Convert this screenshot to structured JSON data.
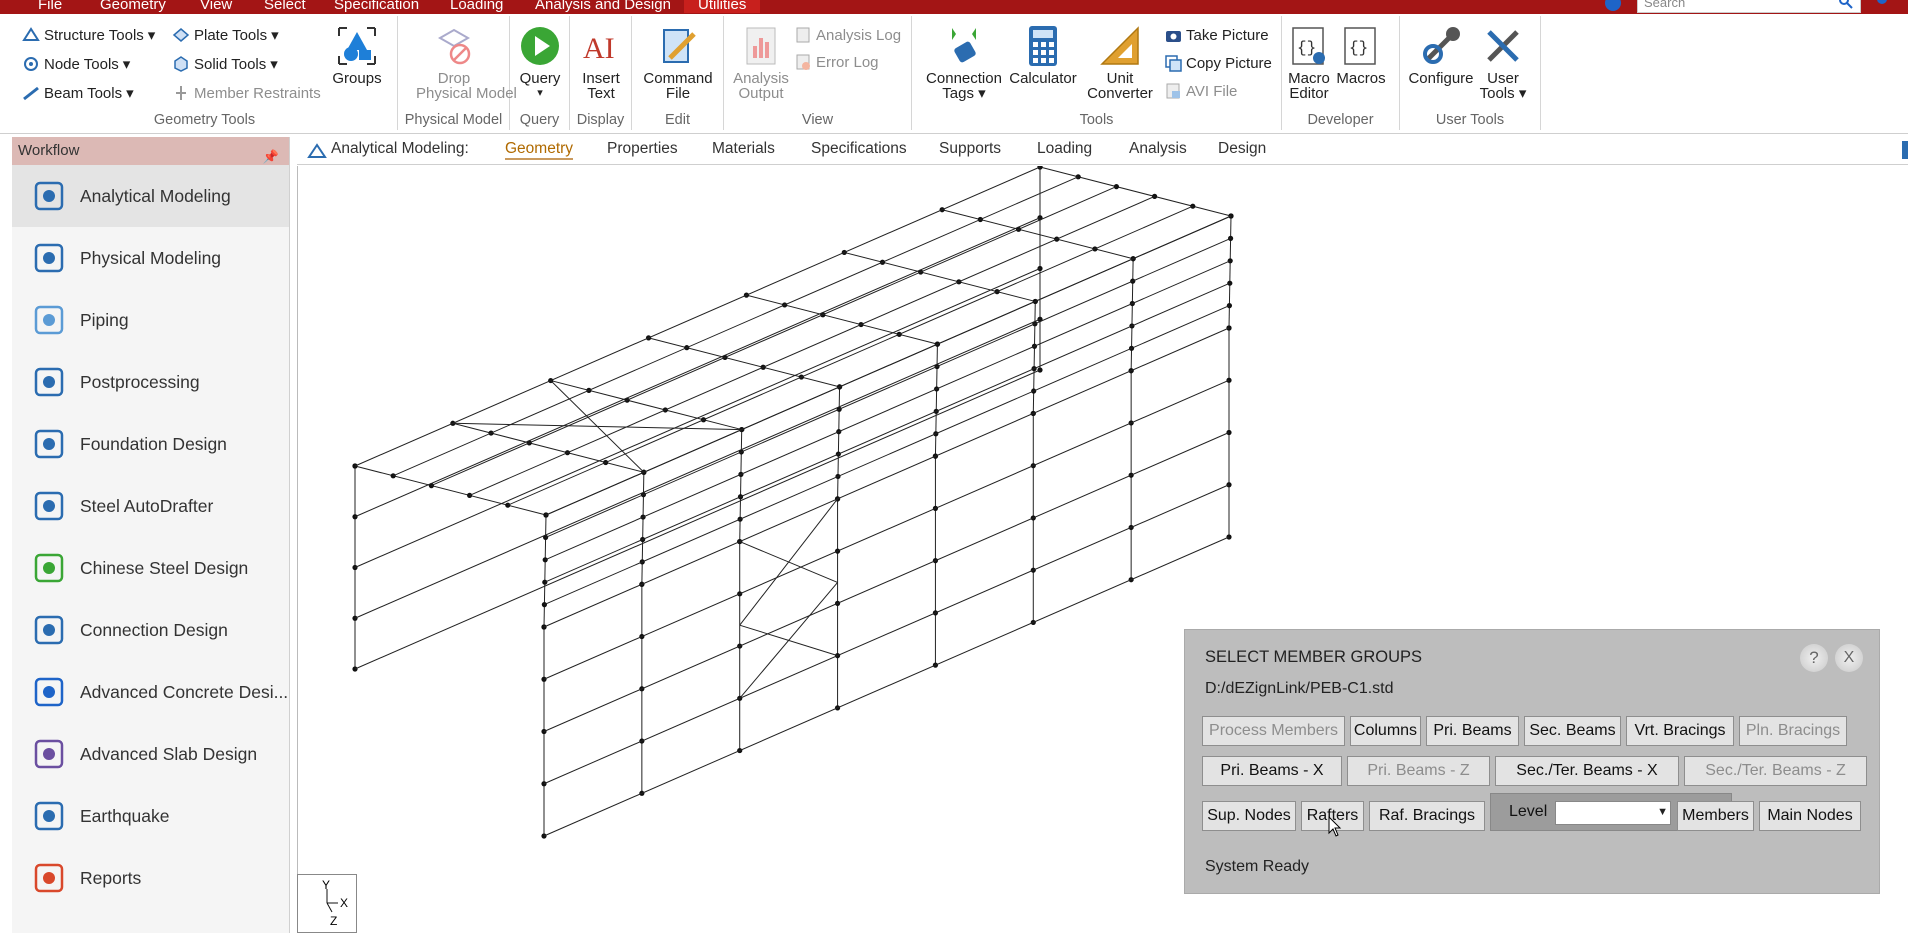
{
  "menubar": {
    "items": [
      "File",
      "Geometry",
      "View",
      "Select",
      "Specification",
      "Loading",
      "Analysis and Design",
      "Utilities"
    ],
    "active": "Utilities",
    "search_placeholder": "Search"
  },
  "ribbon": {
    "geometry_tools": {
      "structure_tools": "Structure Tools",
      "node_tools": "Node Tools",
      "beam_tools": "Beam Tools",
      "plate_tools": "Plate Tools",
      "solid_tools": "Solid Tools",
      "member_restraints": "Member Restraints",
      "groups": "Groups",
      "label": "Geometry Tools"
    },
    "physical_model": {
      "drop_line1": "Drop",
      "drop_line2": "Physical Model",
      "label": "Physical Model"
    },
    "query": {
      "button": "Query",
      "label": "Query"
    },
    "display": {
      "insert_line1": "Insert",
      "insert_line2": "Text",
      "label": "Display"
    },
    "edit": {
      "command_line1": "Command",
      "command_line2": "File",
      "label": "Edit"
    },
    "view": {
      "analysis_output_line1": "Analysis",
      "analysis_output_line2": "Output",
      "analysis_log": "Analysis Log",
      "error_log": "Error Log",
      "label": "View"
    },
    "tools": {
      "connection_line1": "Connection",
      "connection_line2": "Tags",
      "calculator": "Calculator",
      "unit_line1": "Unit",
      "unit_line2": "Converter",
      "take_picture": "Take Picture",
      "copy_picture": "Copy Picture",
      "avi_file": "AVI File",
      "label": "Tools"
    },
    "developer": {
      "macro_editor_line1": "Macro",
      "macro_editor_line2": "Editor",
      "macros": "Macros",
      "label": "Developer"
    },
    "user_tools": {
      "configure": "Configure",
      "user_tools_line1": "User",
      "user_tools_line2": "Tools",
      "label": "User Tools"
    }
  },
  "workflow": {
    "title": "Workflow",
    "items": [
      {
        "label": "Analytical Modeling",
        "icon": "analytical-modeling-icon",
        "selected": true
      },
      {
        "label": "Physical Modeling",
        "icon": "physical-modeling-icon"
      },
      {
        "label": "Piping",
        "icon": "piping-icon"
      },
      {
        "label": "Postprocessing",
        "icon": "postprocessing-icon"
      },
      {
        "label": "Foundation Design",
        "icon": "foundation-design-icon"
      },
      {
        "label": "Steel AutoDrafter",
        "icon": "steel-autodrafter-icon"
      },
      {
        "label": "Chinese Steel Design",
        "icon": "chinese-steel-design-icon"
      },
      {
        "label": "Connection Design",
        "icon": "connection-design-icon"
      },
      {
        "label": "Advanced Concrete Desi...",
        "icon": "advanced-concrete-icon"
      },
      {
        "label": "Advanced Slab Design",
        "icon": "advanced-slab-icon"
      },
      {
        "label": "Earthquake",
        "icon": "earthquake-icon"
      },
      {
        "label": "Reports",
        "icon": "reports-icon"
      }
    ]
  },
  "tabs": {
    "prefix": "Analytical Modeling:",
    "items": [
      "Geometry",
      "Properties",
      "Materials",
      "Specifications",
      "Supports",
      "Loading",
      "Analysis",
      "Design"
    ],
    "active": "Geometry"
  },
  "dialog": {
    "title": "SELECT MEMBER GROUPS",
    "path": "D:/dEZignLink/PEB-C1.std",
    "row1": [
      "Process Members",
      "Columns",
      "Pri. Beams",
      "Sec. Beams",
      "Vrt. Bracings",
      "Pln. Bracings"
    ],
    "row2": [
      "Pri. Beams - X",
      "Pri. Beams - Z",
      "Sec./Ter. Beams - X",
      "Sec./Ter. Beams - Z"
    ],
    "row3": [
      "Sup. Nodes",
      "Rafters",
      "Raf. Bracings"
    ],
    "level_label": "Level",
    "level_value": "",
    "members": "Members",
    "main_nodes": "Main Nodes",
    "status": "System Ready",
    "help": "?",
    "close": "X"
  },
  "axis": {
    "y": "Y",
    "x": "X",
    "z": "Z"
  },
  "colors": {
    "menubar": "#a31515",
    "workflow_header": "#dcb9b5",
    "active_tab": "#b06a00",
    "dialog_bg": "#bdbdbd"
  }
}
